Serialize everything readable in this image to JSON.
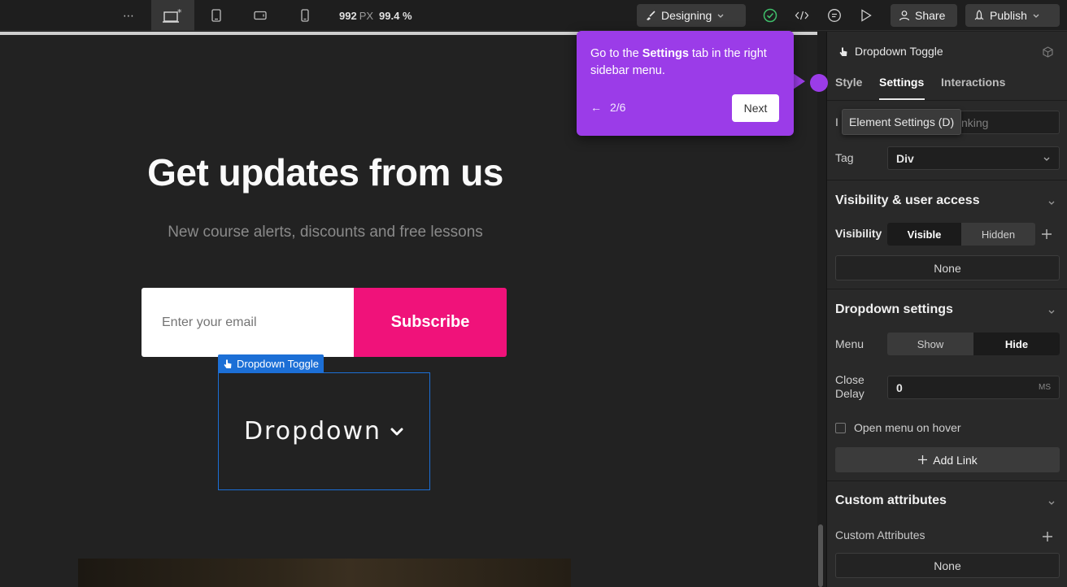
{
  "topbar": {
    "more": "⋯",
    "width_readout": "992",
    "width_unit": "PX",
    "zoom_readout": "99.4 %",
    "mode_label": "Designing",
    "share_label": "Share",
    "publish_label": "Publish"
  },
  "canvas": {
    "title": "Get updates from us",
    "subtitle": "New course alerts, discounts and free lessons",
    "email_placeholder": "Enter your email",
    "subscribe_label": "Subscribe",
    "selected_tag": "Dropdown Toggle",
    "dropdown_text": "Dropdown"
  },
  "popover": {
    "text_before": "Go to the ",
    "text_bold": "Settings",
    "text_after": " tab in the right sidebar menu.",
    "back_arrow": "←",
    "step": "2/6",
    "next_label": "Next"
  },
  "panel": {
    "element_name": "Dropdown Toggle",
    "tabs": [
      {
        "label": "Style"
      },
      {
        "label": "Settings"
      },
      {
        "label": "Interactions"
      }
    ],
    "id_label_partial": "I",
    "id_value_partial": "nking",
    "tooltip": "Element Settings (D)",
    "tag_label": "Tag",
    "tag_value": "Div",
    "visibility_section": "Visibility & user access",
    "visibility_label": "Visibility",
    "visibility_options": [
      "Visible",
      "Hidden"
    ],
    "visibility_none": "None",
    "dropdown_section": "Dropdown settings",
    "menu_label": "Menu",
    "menu_options": [
      "Show",
      "Hide"
    ],
    "close_delay_label_1": "Close",
    "close_delay_label_2": "Delay",
    "close_delay_value": "0",
    "close_delay_unit": "MS",
    "open_on_hover": "Open menu on hover",
    "add_link": "Add Link",
    "custom_section": "Custom attributes",
    "custom_label": "Custom Attributes",
    "custom_none": "None"
  }
}
